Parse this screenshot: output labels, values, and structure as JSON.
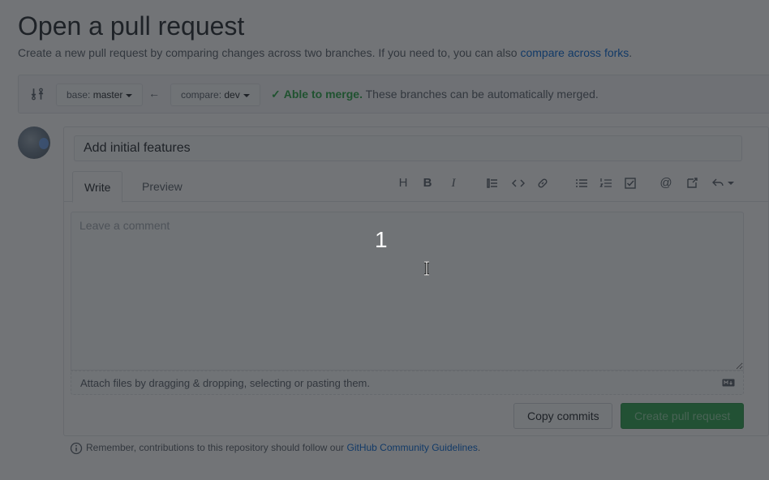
{
  "page": {
    "title": "Open a pull request",
    "subtitle_text": "Create a new pull request by comparing changes across two branches. If you need to, you can also ",
    "subtitle_link": "compare across forks",
    "subtitle_end": "."
  },
  "range": {
    "base_label": "base:",
    "base_branch": "master",
    "compare_label": "compare:",
    "compare_branch": "dev",
    "merge_ok": "Able to merge.",
    "merge_msg": " These branches can be automatically merged."
  },
  "form": {
    "title_value": "Add initial features",
    "tabs": [
      {
        "label": "Write"
      },
      {
        "label": "Preview"
      }
    ],
    "comment_placeholder": "Leave a comment",
    "attach_text": "Attach files by dragging & dropping, selecting or pasting them."
  },
  "toolbar": {
    "icons": [
      "heading-icon",
      "bold-icon",
      "italic-icon",
      "quote-icon",
      "code-icon",
      "link-icon",
      "unordered-list-icon",
      "ordered-list-icon",
      "task-list-icon",
      "mention-icon",
      "cross-reference-icon",
      "reply-icon"
    ]
  },
  "buttons": {
    "copy_commits": "Copy commits",
    "create_pr": "Create pull request"
  },
  "footer": {
    "text": "Remember, contributions to this repository should follow our ",
    "link": "GitHub Community Guidelines",
    "end": "."
  },
  "overlay": {
    "step_number": "1"
  },
  "colors": {
    "link": "#0366d6",
    "success": "#28a745",
    "primary_button": "#2ea44f",
    "overlay": "#1b1f23"
  }
}
